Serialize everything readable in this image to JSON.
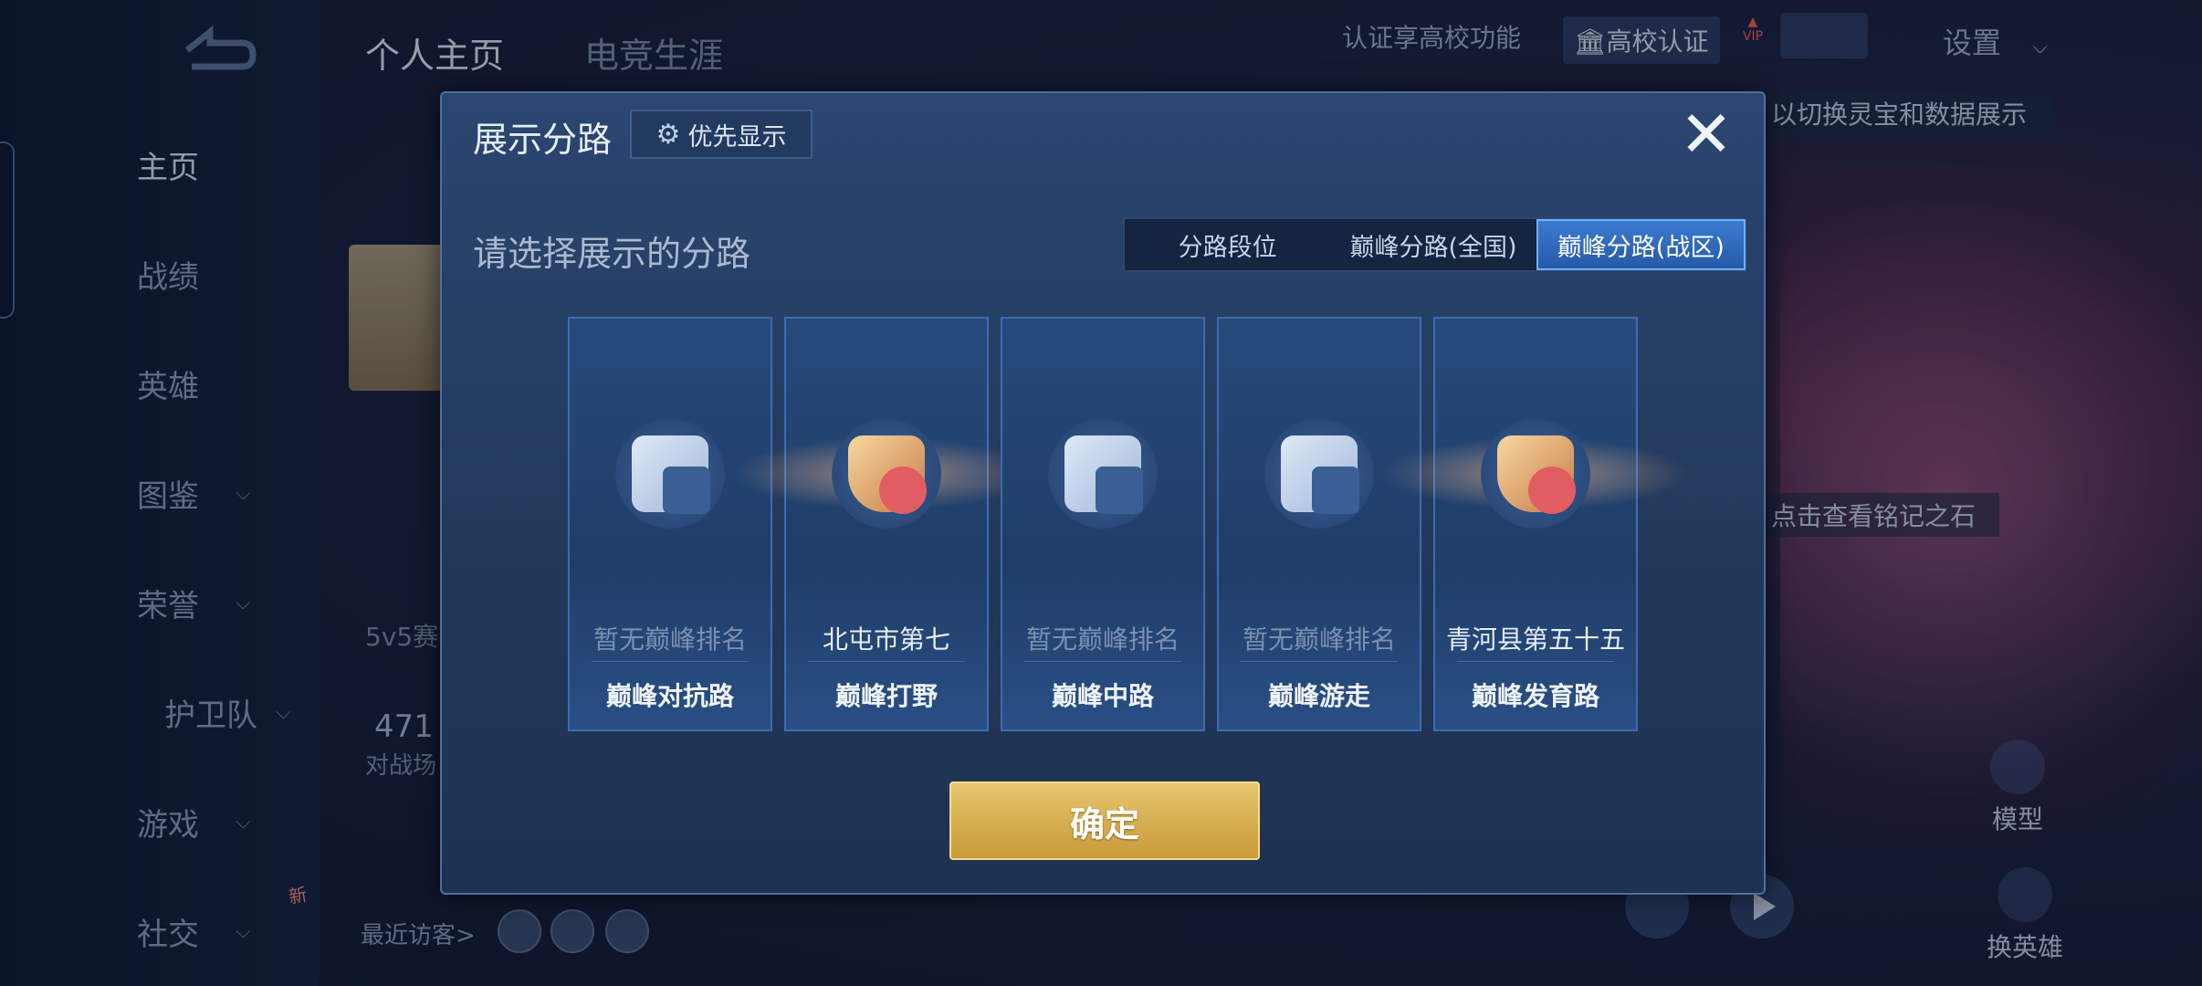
{
  "nav": {
    "items": [
      {
        "label": "主页",
        "chevron": false
      },
      {
        "label": "战绩",
        "chevron": false
      },
      {
        "label": "英雄",
        "chevron": false
      },
      {
        "label": "图鉴",
        "chevron": true
      },
      {
        "label": "荣誉",
        "chevron": true
      },
      {
        "label": "护卫队",
        "chevron": true
      },
      {
        "label": "游戏",
        "chevron": true
      },
      {
        "label": "社交",
        "chevron": true
      }
    ],
    "new_badge": "新"
  },
  "top": {
    "tab_profile": "个人主页",
    "tab_career": "电竞生涯",
    "verify_text": "认证享高校功能",
    "verify_button": "高校认证",
    "vip": "VIP",
    "settings": "设置"
  },
  "background": {
    "hint_right": "以切换灵宝和数据展示",
    "stone_hint": "点击查看铭记之石",
    "mode_text": "5v5赛",
    "count_text": "471",
    "count_label": "对战场",
    "visitors": "最近访客>",
    "model_label": "模型",
    "change_hero_label": "换英雄"
  },
  "modal": {
    "title": "展示分路",
    "priority_button": "优先显示",
    "close": "✕",
    "subtitle": "请选择展示的分路",
    "filters": [
      "分路段位",
      "巅峰分路(全国)",
      "巅峰分路(战区)"
    ],
    "active_filter": 2,
    "cards": [
      {
        "rank": "暂无巅峰排名",
        "lane": "巅峰对抗路",
        "ranked": false,
        "icon": "clash-lane-icon"
      },
      {
        "rank": "北屯市第七",
        "lane": "巅峰打野",
        "ranked": true,
        "icon": "jungle-badge-icon"
      },
      {
        "rank": "暂无巅峰排名",
        "lane": "巅峰中路",
        "ranked": false,
        "icon": "mid-lane-icon"
      },
      {
        "rank": "暂无巅峰排名",
        "lane": "巅峰游走",
        "ranked": false,
        "icon": "roam-icon"
      },
      {
        "rank": "青河县第五十五",
        "lane": "巅峰发育路",
        "ranked": true,
        "icon": "farm-lane-badge-icon"
      }
    ],
    "confirm": "确定"
  }
}
